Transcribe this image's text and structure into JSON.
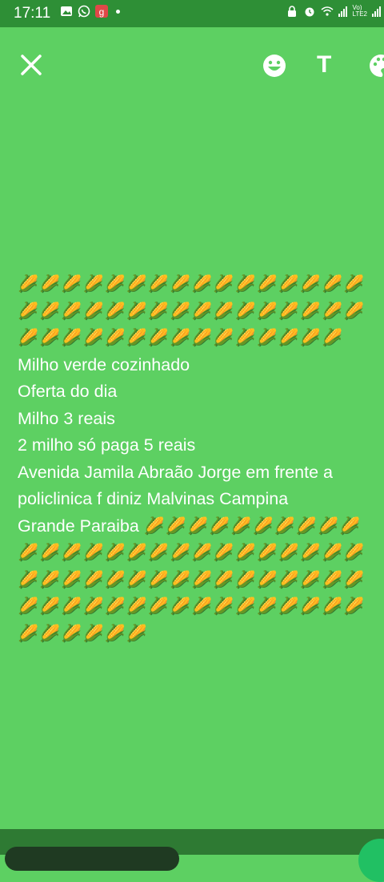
{
  "status_bar": {
    "time": "17:11",
    "network_label": "Vo)\nLTE2"
  },
  "toolbar": {
    "close_icon": "close-icon",
    "emoji_icon": "emoji-icon",
    "text_tool_label": "T",
    "palette_icon": "palette-icon"
  },
  "status_text": {
    "corn_row_1": "🌽🌽🌽🌽🌽🌽🌽🌽🌽🌽🌽🌽🌽🌽🌽🌽",
    "corn_row_2": "🌽🌽🌽🌽🌽🌽🌽🌽🌽🌽🌽🌽🌽🌽🌽🌽",
    "corn_row_3": "🌽🌽🌽🌽🌽🌽🌽🌽🌽🌽🌽🌽🌽🌽🌽",
    "line_1": "Milho verde cozinhado",
    "line_2": "Oferta do dia",
    "line_3": "Milho 3 reais",
    "line_4": "2 milho só paga 5 reais",
    "line_5": "Avenida Jamila Abraão Jorge em frente a",
    "line_6": "policlinica f diniz Malvinas Campina",
    "line_7_text": "Grande Paraiba ",
    "line_7_corn": "🌽🌽🌽🌽🌽🌽🌽🌽🌽🌽",
    "corn_row_4": "🌽🌽🌽🌽🌽🌽🌽🌽🌽🌽🌽🌽🌽🌽🌽🌽",
    "corn_row_5": "🌽🌽🌽🌽🌽🌽🌽🌽🌽🌽🌽🌽🌽🌽🌽🌽",
    "corn_row_6": "🌽🌽🌽🌽🌽🌽🌽🌽🌽🌽🌽🌽🌽🌽🌽🌽",
    "corn_row_7": "🌽🌽🌽🌽🌽🌽"
  },
  "colors": {
    "background": "#5dd062",
    "status_bar": "#2e8f36"
  }
}
